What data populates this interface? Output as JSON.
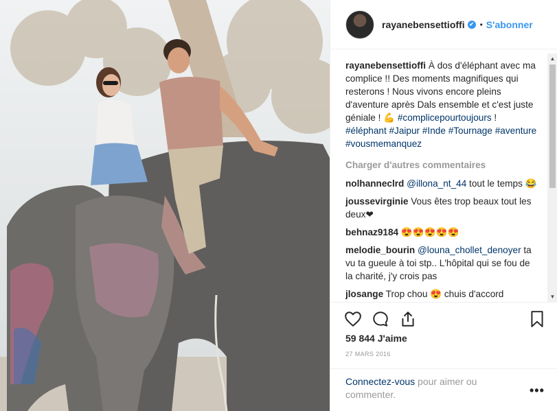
{
  "header": {
    "username": "rayanebensettioffi",
    "verified_icon": "✔",
    "separator": "•",
    "follow_label": "S'abonner"
  },
  "caption": {
    "username": "rayanebensettioffi",
    "text_1": " À dos d'éléphant avec ma complice !! Des moments magnifiques qui resterons ! Nous vivons encore pleins d'aventure après Dals ensemble et c'est juste géniale ! 💪 ",
    "hashtag_1": "#complicepourtoujours",
    "text_2": " ! ",
    "hashtag_2": "#éléphant",
    "hashtag_3": "#Jaipur",
    "hashtag_4": "#Inde",
    "hashtag_5": "#Tournage",
    "hashtag_6": "#aventure",
    "hashtag_7": "#vousmemanquez"
  },
  "load_more_label": "Charger d'autres commentaires",
  "comments": [
    {
      "user": "nolhanneclrd",
      "mention": "@illona_nt_44",
      "text": " tout le temps 😂"
    },
    {
      "user": "joussevirginie",
      "mention": "",
      "text": " Vous êtes trop beaux tout les deux❤"
    },
    {
      "user": "behnaz9184",
      "mention": "",
      "text": " 😍😍😍😍😍"
    },
    {
      "user": "melodie_bourin",
      "mention": "@louna_chollet_denoyer",
      "text": " ta vu ta gueule à toi stp.. L'hôpital qui se fou de la charité, j'y crois pas"
    },
    {
      "user": "jlosange",
      "mention": "",
      "text": " Trop chou 😍 chuis d'accord avec@joussevirginie"
    }
  ],
  "likes_label": "59 844 J'aime",
  "date_label": "27 MARS 2016",
  "footer": {
    "login_link": "Connectez-vous",
    "login_text": " pour aimer ou commenter.",
    "more_label": "•••"
  },
  "colors": {
    "link": "#003569",
    "accent": "#3897f0",
    "muted": "#999999"
  }
}
